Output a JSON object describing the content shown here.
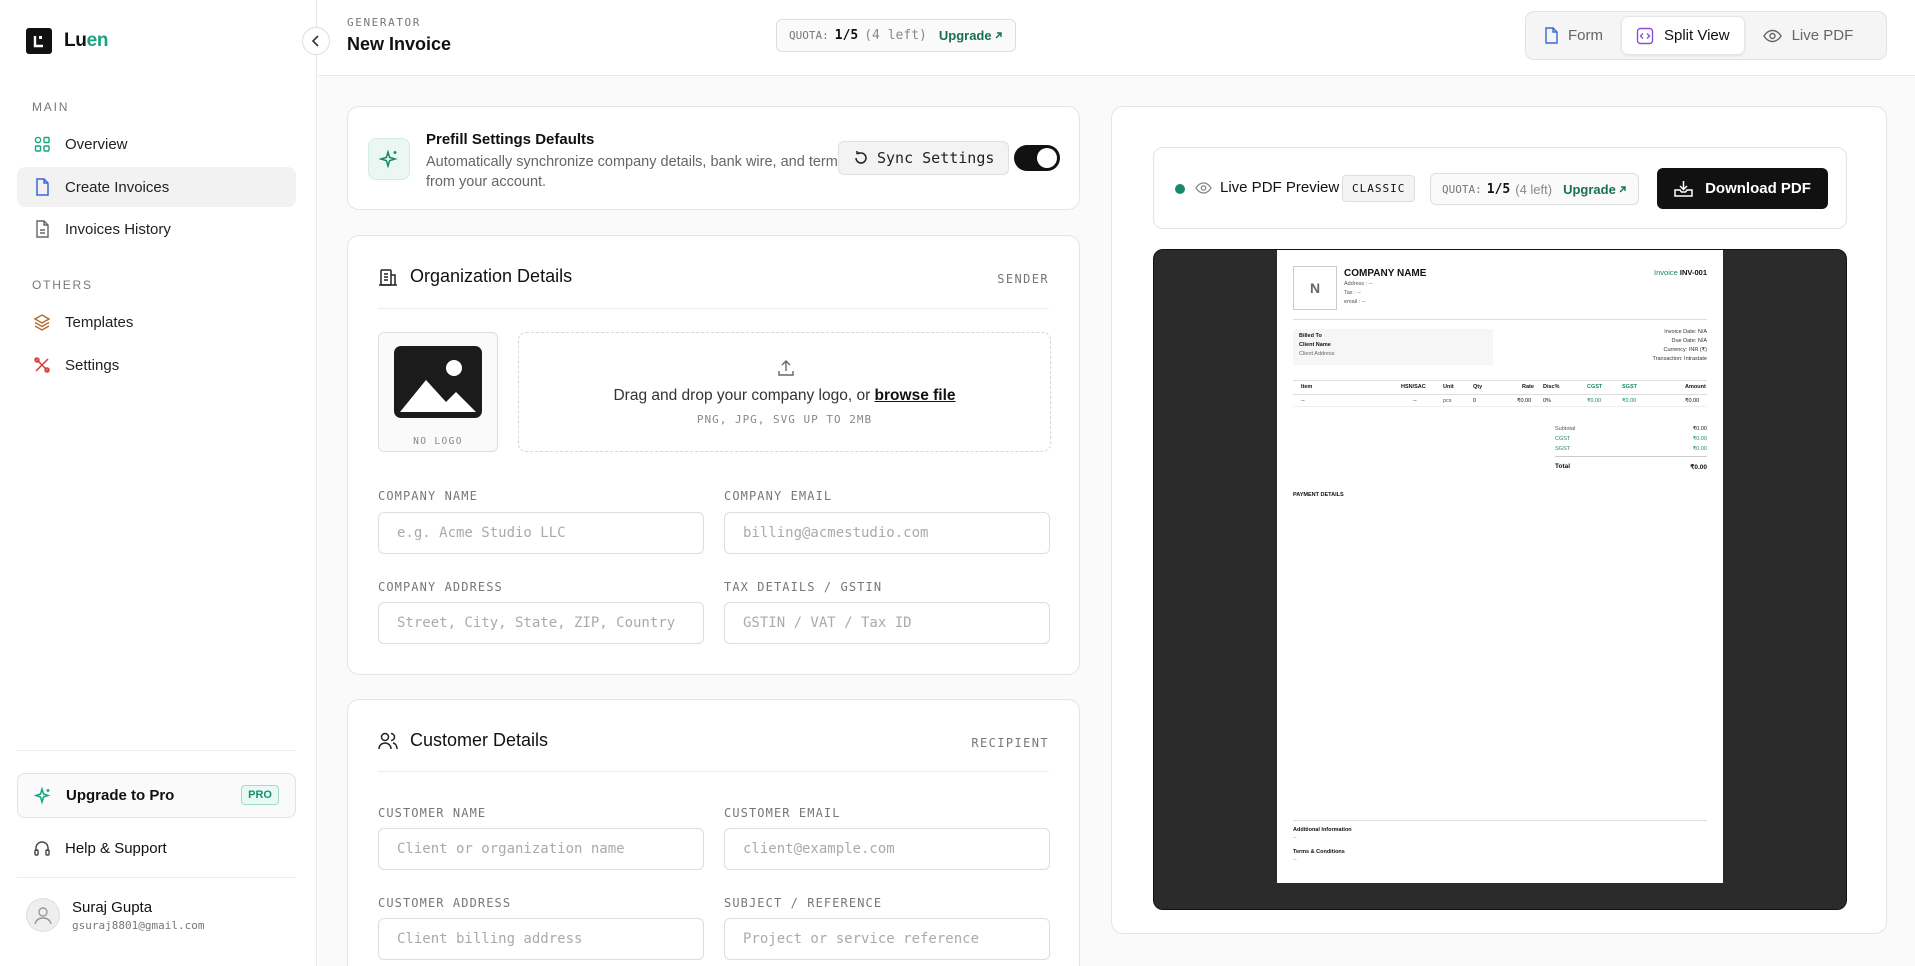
{
  "app": {
    "name_a": "Lu",
    "name_b": "en"
  },
  "sidebar": {
    "main_label": "MAIN",
    "others_label": "OTHERS",
    "items": [
      {
        "label": "Overview",
        "icon": "grid-icon"
      },
      {
        "label": "Create Invoices",
        "icon": "file-icon",
        "active": true
      },
      {
        "label": "Invoices History",
        "icon": "file-text-icon"
      },
      {
        "label": "Templates",
        "icon": "layers-icon"
      },
      {
        "label": "Settings",
        "icon": "tools-icon"
      }
    ],
    "upgrade_label": "Upgrade to Pro",
    "pro_badge": "PRO",
    "help_label": "Help & Support",
    "user": {
      "name": "Suraj Gupta",
      "email": "gsuraj8801@gmail.com"
    }
  },
  "header": {
    "kicker": "GENERATOR",
    "title": "New Invoice",
    "quota_label": "QUOTA:",
    "quota_value": "1/5",
    "quota_left": "(4 left)",
    "upgrade": "Upgrade",
    "views": [
      {
        "label": "Form",
        "icon": "file-icon"
      },
      {
        "label": "Split View",
        "icon": "code-icon",
        "active": true
      },
      {
        "label": "Live PDF",
        "icon": "eye-icon"
      }
    ]
  },
  "prefill": {
    "title": "Prefill Settings Defaults",
    "desc": "Automatically synchronize company details, bank wire, and terms from your account.",
    "sync_label": "Sync Settings",
    "toggle_on": true
  },
  "organization": {
    "title": "Organization Details",
    "tag": "SENDER",
    "no_logo": "NO LOGO",
    "drop_text": "Drag and drop your company logo, or",
    "browse": "browse file",
    "drop_sub": "PNG, JPG, SVG UP TO 2MB",
    "fields": [
      {
        "label": "COMPANY NAME",
        "placeholder": "e.g. Acme Studio LLC"
      },
      {
        "label": "COMPANY EMAIL",
        "placeholder": "billing@acmestudio.com"
      },
      {
        "label": "COMPANY ADDRESS",
        "placeholder": "Street, City, State, ZIP, Country"
      },
      {
        "label": "TAX DETAILS / GSTIN",
        "placeholder": "GSTIN / VAT / Tax ID"
      }
    ]
  },
  "customer": {
    "title": "Customer Details",
    "tag": "RECIPIENT",
    "fields": [
      {
        "label": "CUSTOMER NAME",
        "placeholder": "Client or organization name"
      },
      {
        "label": "CUSTOMER EMAIL",
        "placeholder": "client@example.com"
      },
      {
        "label": "CUSTOMER ADDRESS",
        "placeholder": "Client billing address"
      },
      {
        "label": "SUBJECT / REFERENCE",
        "placeholder": "Project or service reference"
      }
    ]
  },
  "preview": {
    "title": "Live PDF Preview",
    "template": "CLASSIC",
    "quota_label": "QUOTA:",
    "quota_value": "1/5",
    "quota_left": "(4 left)",
    "upgrade": "Upgrade",
    "download": "Download PDF",
    "pdf": {
      "logo_letter": "N",
      "company": "COMPANY NAME",
      "address": "Address : --",
      "tax": "Tax : --",
      "email": "email : --",
      "invoice_label": "Invoice",
      "invoice_no": "INV-001",
      "billed_to": "Billed To",
      "client_name": "Client Name",
      "client_addr": "Client Address",
      "invoice_date": "Invoice Date: N/A",
      "due_date": "Due Date: N/A",
      "currency": "Currency: INR (₹)",
      "transaction": "Transaction: Intrastate",
      "cols": [
        "Item",
        "HSN/SAC",
        "Unit",
        "Qty",
        "Rate",
        "Disc%",
        "CGST",
        "SGST",
        "Amount"
      ],
      "row": [
        "--",
        "--",
        "pcs",
        "0",
        "₹0.00",
        "0%",
        "₹0.00",
        "₹0.00",
        "₹0.00"
      ],
      "subtotal_label": "Subtotal",
      "subtotal": "₹0.00",
      "cgst_label": "CGST",
      "cgst": "₹0.00",
      "sgst_label": "SGST",
      "sgst": "₹0.00",
      "total_label": "Total",
      "total": "₹0.00",
      "payment": "PAYMENT DETAILS",
      "additional": "Additional Information",
      "terms": "Terms & Conditions",
      "dash": "--"
    }
  }
}
